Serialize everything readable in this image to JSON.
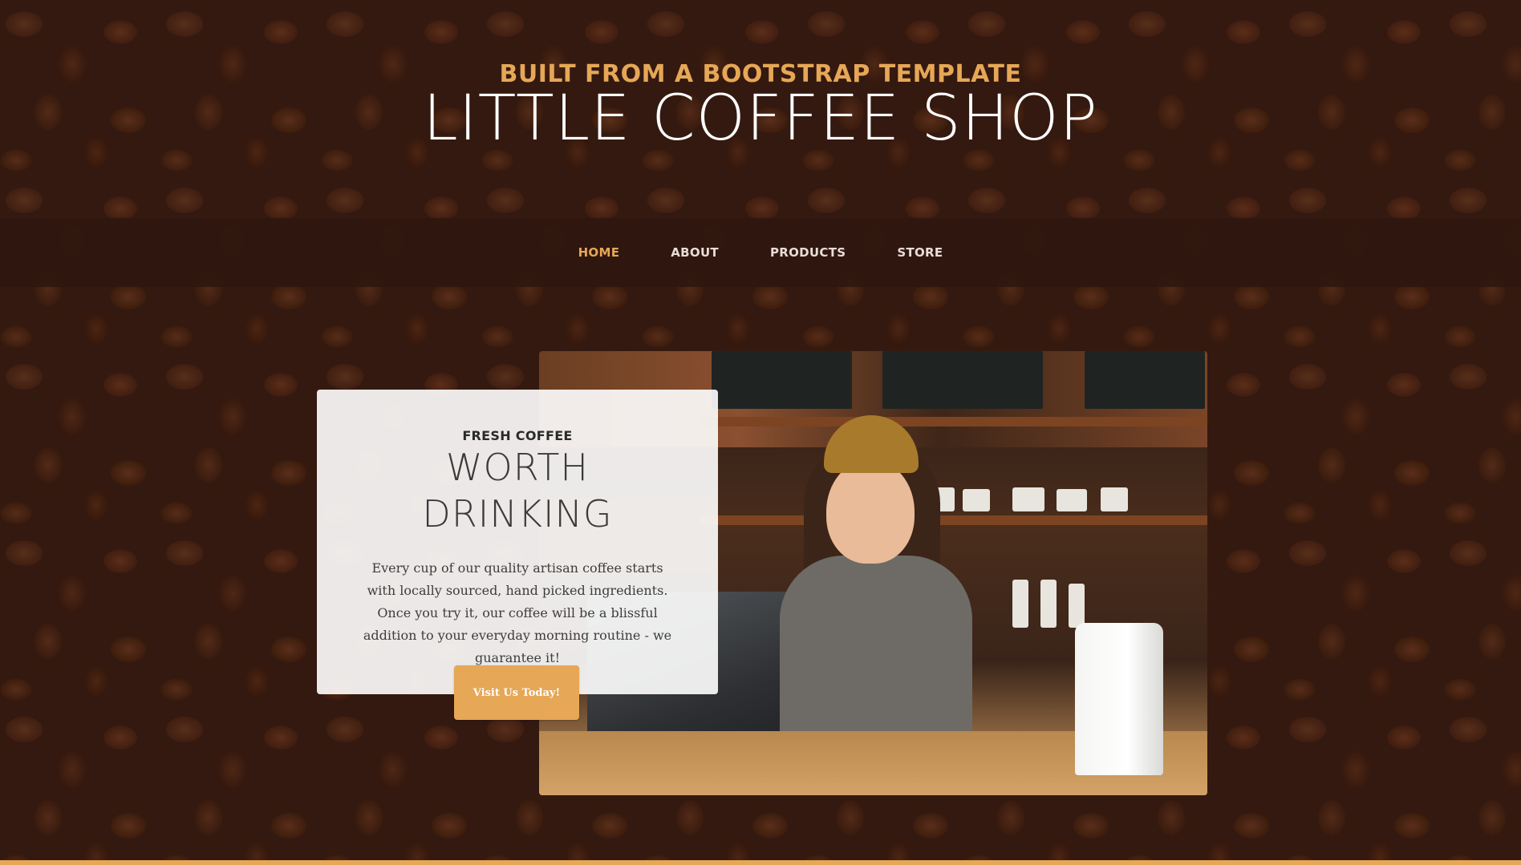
{
  "header": {
    "upper": "BUILT FROM A BOOTSTRAP TEMPLATE",
    "lower": "LITTLE COFFEE SHOP"
  },
  "nav": {
    "items": [
      {
        "label": "HOME",
        "active": true
      },
      {
        "label": "ABOUT",
        "active": false
      },
      {
        "label": "PRODUCTS",
        "active": false
      },
      {
        "label": "STORE",
        "active": false
      }
    ]
  },
  "intro": {
    "upper": "FRESH COFFEE",
    "lower_line1": "WORTH",
    "lower_line2": "DRINKING",
    "body": "Every cup of our quality artisan coffee starts with locally sourced, hand picked ingredients. Once you try it, our coffee will be a blissful addition to your everyday morning routine - we guarantee it!",
    "button_label": "Visit Us Today!"
  },
  "colors": {
    "accent": "#e6a756",
    "navbar": "#2f170f",
    "background": "#3a1d12"
  }
}
